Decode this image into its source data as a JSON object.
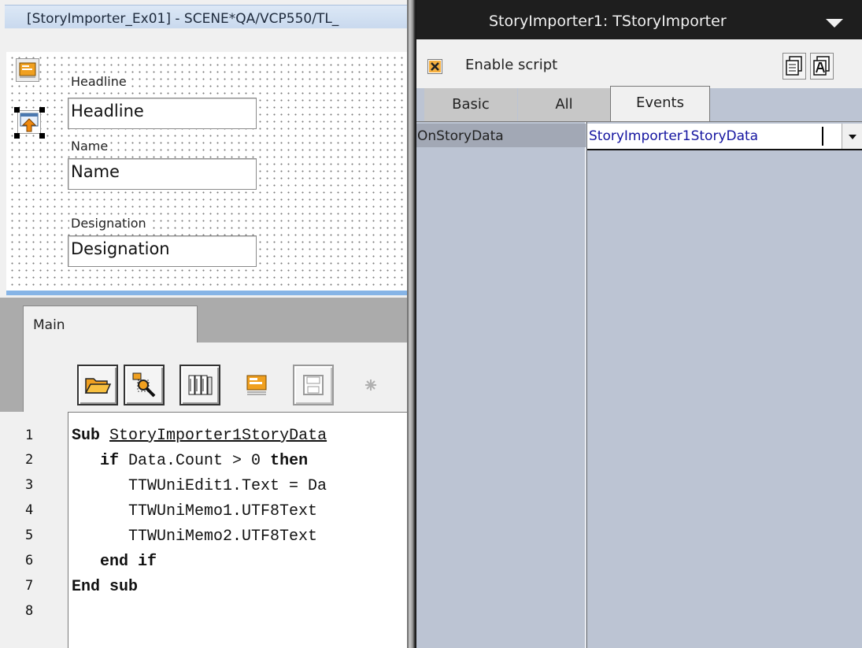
{
  "designer": {
    "window_title": "[StoryImporter_Ex01] - SCENE*QA/VCP550/TL_",
    "components": [
      {
        "label": "Headline",
        "value": "Headline"
      },
      {
        "label": "Name",
        "value": "Name"
      },
      {
        "label": "Designation",
        "value": "Designation"
      }
    ],
    "component_icons": [
      "uni-edit-icon",
      "story-importer-icon"
    ]
  },
  "editor": {
    "tab_label": "Main",
    "toolbar": [
      {
        "name": "open-folder-icon",
        "enabled": true
      },
      {
        "name": "find-icon",
        "enabled": true
      },
      {
        "name": "library-icon",
        "enabled": true
      },
      {
        "name": "component-icon",
        "enabled": true
      },
      {
        "name": "save-icon",
        "enabled": false
      },
      {
        "name": "clear-icon",
        "enabled": false
      }
    ],
    "line_numbers": [
      "1",
      "2",
      "3",
      "4",
      "5",
      "6",
      "7",
      "8"
    ],
    "code_lines": [
      {
        "kw": "Sub",
        "rest": "StoryImporter1StoryData"
      },
      {
        "kw_indent": "   ",
        "kw": "if",
        "rest": " Data.Count > 0 ",
        "kw2": "then"
      },
      {
        "text": "      TTWUniEdit1.Text = Da"
      },
      {
        "text": "      TTWUniMemo1.UTF8Text"
      },
      {
        "text": "      TTWUniMemo2.UTF8Text"
      },
      {
        "text": "   end if"
      },
      {
        "text": "End sub"
      },
      {
        "text": ""
      }
    ]
  },
  "inspector": {
    "title": "StoryImporter1: TStoryImporter",
    "enable_script_label": "Enable script",
    "enable_script_checked": true,
    "toolbar_icons": [
      "copy-properties-icon",
      "font-properties-icon"
    ],
    "tabs": [
      "Basic",
      "All",
      "Events"
    ],
    "active_tab": "Events",
    "event_name": "OnStoryData",
    "event_value": "StoryImporter1StoryData"
  },
  "colors": {
    "inspector_bg": "#bcc4d3",
    "selected_row": "#a2a8b5",
    "value_text": "#1414a0",
    "checkbox_mark": "#e08a00",
    "designer_border": "#86b4e6"
  }
}
